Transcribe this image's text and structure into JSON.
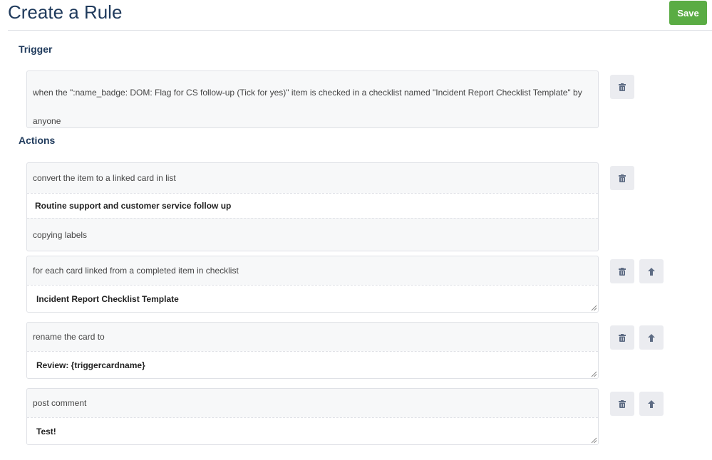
{
  "header": {
    "title": "Create a Rule",
    "save_label": "Save"
  },
  "trigger": {
    "heading": "Trigger",
    "text": "when the \":name_badge: DOM: Flag for CS follow-up (Tick for yes)\" item is checked in a checklist named \"Incident Report Checklist Template\" by anyone"
  },
  "actions": {
    "heading": "Actions",
    "items": [
      {
        "label": "convert the item to a linked card in list",
        "value": "Routine support and customer service follow up",
        "suffix": "copying labels"
      },
      {
        "label": "for each card linked from a completed item in checklist",
        "value": "Incident Report Checklist Template"
      },
      {
        "label": "rename the card to",
        "value": "Review: {triggercardname}"
      },
      {
        "label": "post comment",
        "value": "Test!"
      }
    ]
  },
  "icons": {
    "delete": "trash-icon",
    "move_up": "arrow-up-icon"
  },
  "colors": {
    "accent": "#5aac44",
    "title": "#1f3a5c",
    "button_bg": "#ebecf0"
  }
}
